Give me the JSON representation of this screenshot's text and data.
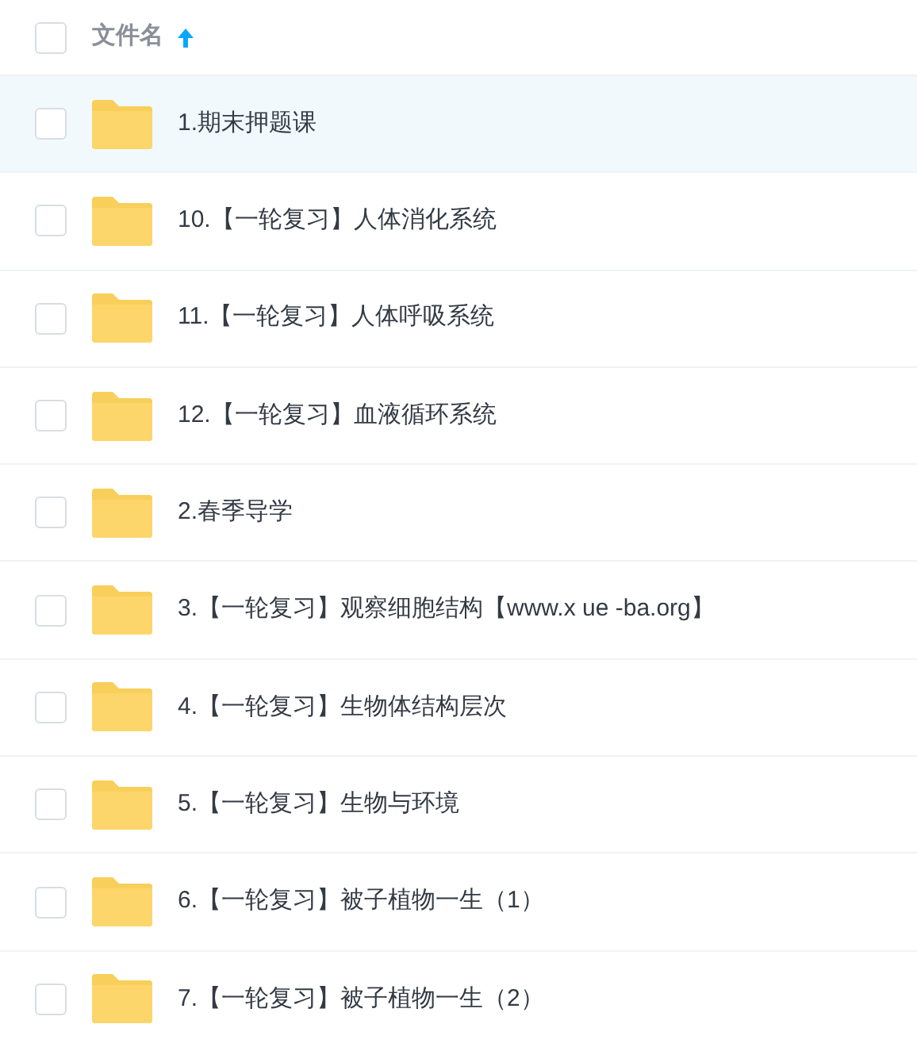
{
  "header": {
    "label": "文件名",
    "checked": false,
    "sort_ascending": true
  },
  "files": [
    {
      "name": "1.期末押题课",
      "selected": true,
      "checked": false
    },
    {
      "name": "10.【一轮复习】人体消化系统",
      "selected": false,
      "checked": false
    },
    {
      "name": "11.【一轮复习】人体呼吸系统",
      "selected": false,
      "checked": false
    },
    {
      "name": "12.【一轮复习】血液循环系统",
      "selected": false,
      "checked": false
    },
    {
      "name": "2.春季导学",
      "selected": false,
      "checked": false
    },
    {
      "name": "3.【一轮复习】观察细胞结构【www.x ue -ba.org】",
      "selected": false,
      "checked": false
    },
    {
      "name": "4.【一轮复习】生物体结构层次",
      "selected": false,
      "checked": false
    },
    {
      "name": "5.【一轮复习】生物与环境",
      "selected": false,
      "checked": false
    },
    {
      "name": "6.【一轮复习】被子植物一生（1）",
      "selected": false,
      "checked": false
    },
    {
      "name": "7.【一轮复习】被子植物一生（2）",
      "selected": false,
      "checked": false
    }
  ]
}
